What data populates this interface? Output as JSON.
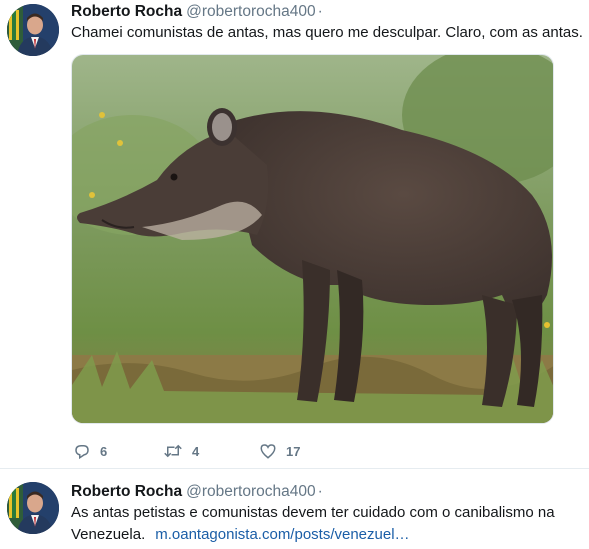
{
  "tweets": [
    {
      "author": {
        "name": "Roberto Rocha",
        "handle": "@robertorocha400",
        "dot": "·"
      },
      "text": "Chamei comunistas de antas, mas quero me desculpar. Claro, com as antas.",
      "media": {
        "alt": "tapir"
      },
      "actions": {
        "reply": {
          "icon": "reply-icon",
          "count": "6"
        },
        "retweet": {
          "icon": "retweet-icon",
          "count": "4"
        },
        "like": {
          "icon": "heart-icon",
          "count": "17"
        }
      }
    },
    {
      "author": {
        "name": "Roberto Rocha",
        "handle": "@robertorocha400",
        "dot": "·"
      },
      "text": "As antas petistas e comunistas devem ter cuidado com o canibalismo na Venezuela.",
      "link": "m.oantagonista.com/posts/venezuel…"
    }
  ],
  "colors": {
    "text": "#14171a",
    "secondary": "#657786",
    "link": "#1b5ea7",
    "divider": "#e6ecf0"
  }
}
